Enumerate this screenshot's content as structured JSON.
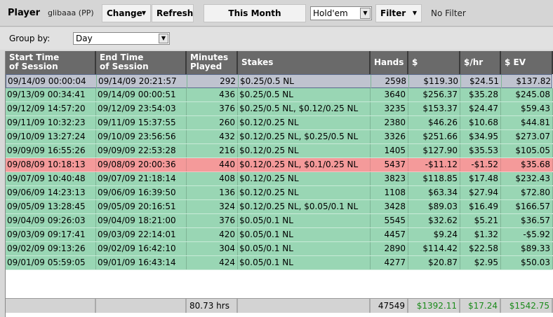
{
  "toolbar": {
    "player_label": "Player",
    "player_name": "glibaaa (PP)",
    "change_label": "Change",
    "refresh_label": "Refresh",
    "period_label": "This Month",
    "game_select": "Hold'em",
    "filter_label": "Filter",
    "filter_status": "No Filter"
  },
  "groupby": {
    "label": "Group by:",
    "value": "Day"
  },
  "table": {
    "headers": [
      "Start Time\nof Session",
      "End Time\nof Session",
      "Minutes\nPlayed",
      "Stakes",
      "Hands",
      "$",
      "$/hr",
      "$ EV"
    ],
    "rows": [
      {
        "start": "09/14/09 00:00:04",
        "end": "09/14/09 20:21:57",
        "minutes": "292",
        "stakes": "$0.25/0.5 NL",
        "hands": "2598",
        "dollars": "$119.30",
        "per_hr": "$24.51",
        "ev": "$137.82",
        "state": "selected"
      },
      {
        "start": "09/13/09 00:34:41",
        "end": "09/14/09 00:00:51",
        "minutes": "436",
        "stakes": "$0.25/0.5 NL",
        "hands": "3640",
        "dollars": "$256.37",
        "per_hr": "$35.28",
        "ev": "$245.08",
        "state": "win"
      },
      {
        "start": "09/12/09 14:57:20",
        "end": "09/12/09 23:54:03",
        "minutes": "376",
        "stakes": "$0.25/0.5 NL, $0.12/0.25 NL",
        "hands": "3235",
        "dollars": "$153.37",
        "per_hr": "$24.47",
        "ev": "$59.43",
        "state": "win"
      },
      {
        "start": "09/11/09 10:32:23",
        "end": "09/11/09 15:37:55",
        "minutes": "260",
        "stakes": "$0.12/0.25 NL",
        "hands": "2380",
        "dollars": "$46.26",
        "per_hr": "$10.68",
        "ev": "$44.81",
        "state": "win"
      },
      {
        "start": "09/10/09 13:27:24",
        "end": "09/10/09 23:56:56",
        "minutes": "432",
        "stakes": "$0.12/0.25 NL, $0.25/0.5 NL",
        "hands": "3326",
        "dollars": "$251.66",
        "per_hr": "$34.95",
        "ev": "$273.07",
        "state": "win"
      },
      {
        "start": "09/09/09 16:55:26",
        "end": "09/09/09 22:53:28",
        "minutes": "216",
        "stakes": "$0.12/0.25 NL",
        "hands": "1405",
        "dollars": "$127.90",
        "per_hr": "$35.53",
        "ev": "$105.05",
        "state": "win"
      },
      {
        "start": "09/08/09 10:18:13",
        "end": "09/08/09 20:00:36",
        "minutes": "440",
        "stakes": "$0.12/0.25 NL, $0.1/0.25 NL",
        "hands": "5437",
        "dollars": "-$11.12",
        "per_hr": "-$1.52",
        "ev": "$35.68",
        "state": "loss"
      },
      {
        "start": "09/07/09 10:40:48",
        "end": "09/07/09 21:18:14",
        "minutes": "408",
        "stakes": "$0.12/0.25 NL",
        "hands": "3823",
        "dollars": "$118.85",
        "per_hr": "$17.48",
        "ev": "$232.43",
        "state": "win"
      },
      {
        "start": "09/06/09 14:23:13",
        "end": "09/06/09 16:39:50",
        "minutes": "136",
        "stakes": "$0.12/0.25 NL",
        "hands": "1108",
        "dollars": "$63.34",
        "per_hr": "$27.94",
        "ev": "$72.80",
        "state": "win"
      },
      {
        "start": "09/05/09 13:28:45",
        "end": "09/05/09 20:16:51",
        "minutes": "324",
        "stakes": "$0.12/0.25 NL, $0.05/0.1 NL",
        "hands": "3428",
        "dollars": "$89.03",
        "per_hr": "$16.49",
        "ev": "$166.57",
        "state": "win"
      },
      {
        "start": "09/04/09 09:26:03",
        "end": "09/04/09 18:21:00",
        "minutes": "376",
        "stakes": "$0.05/0.1 NL",
        "hands": "5545",
        "dollars": "$32.62",
        "per_hr": "$5.21",
        "ev": "$36.57",
        "state": "win"
      },
      {
        "start": "09/03/09 09:17:41",
        "end": "09/03/09 22:14:01",
        "minutes": "420",
        "stakes": "$0.05/0.1 NL",
        "hands": "4457",
        "dollars": "$9.24",
        "per_hr": "$1.32",
        "ev": "-$5.92",
        "state": "win"
      },
      {
        "start": "09/02/09 09:13:26",
        "end": "09/02/09 16:42:10",
        "minutes": "304",
        "stakes": "$0.05/0.1 NL",
        "hands": "2890",
        "dollars": "$114.42",
        "per_hr": "$22.58",
        "ev": "$89.33",
        "state": "win"
      },
      {
        "start": "09/01/09 05:59:05",
        "end": "09/01/09 16:43:14",
        "minutes": "424",
        "stakes": "$0.05/0.1 NL",
        "hands": "4277",
        "dollars": "$20.87",
        "per_hr": "$2.95",
        "ev": "$50.03",
        "state": "win"
      }
    ],
    "totals": {
      "minutes": "80.73 hrs",
      "hands": "47549",
      "dollars": "$1392.11",
      "per_hr": "$17.24",
      "ev": "$1542.75"
    }
  },
  "colors": {
    "win_row": "#99d6b4",
    "loss_row": "#f49a9a",
    "selected_row": "#bfc3cf",
    "header_bg": "#6a6a6a",
    "totals_text": "#1a8a1a"
  }
}
